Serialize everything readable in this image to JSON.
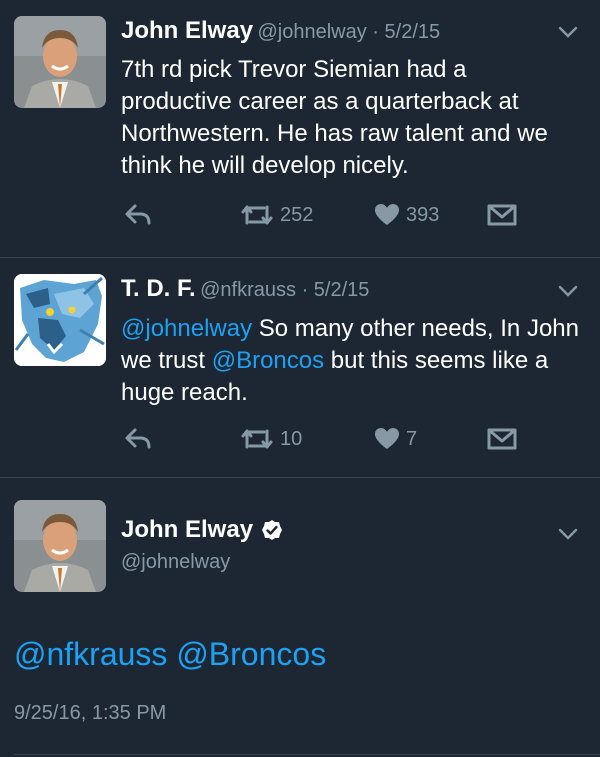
{
  "tweets": [
    {
      "name": "John Elway",
      "handle": "@johnelway",
      "sep": " · ",
      "date": "5/2/15",
      "text": "7th rd pick Trevor Siemian had a productive career as a quarterback at Northwestern. He has raw talent and we think he will develop nicely.",
      "retweets": "252",
      "likes": "393"
    },
    {
      "name": "T. D. F.",
      "handle": "@nfkrauss",
      "sep": " · ",
      "date": "5/2/15",
      "mention1": "@johnelway",
      "text1": " So many other needs, In John we trust ",
      "mention2": "@Broncos",
      "text2": " but this seems like a huge reach.",
      "retweets": "10",
      "likes": "7"
    }
  ],
  "detail": {
    "name": "John Elway",
    "handle": "@johnelway",
    "mention1": "@nfkrauss",
    "space": " ",
    "mention2": "@Broncos",
    "timestamp": "9/25/16, 1:35 PM"
  },
  "colors": {
    "background": "#1c2733",
    "link": "#1da1f2",
    "muted": "#8899a6",
    "divider": "#38444d"
  },
  "icons": [
    "chevron-down-icon",
    "reply-icon",
    "retweet-icon",
    "heart-icon",
    "direct-message-icon",
    "verified-icon"
  ]
}
